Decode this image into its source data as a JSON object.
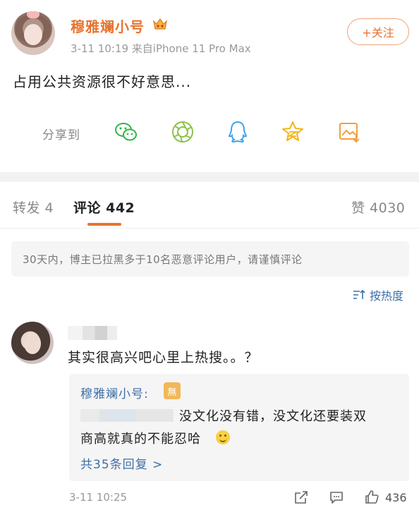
{
  "post": {
    "username": "穆雅斓小号",
    "meta": "3-11 10:19  来自iPhone 11 Pro Max",
    "follow_label": "+关注",
    "text": "占用公共资源很不好意思..."
  },
  "share": {
    "label": "分享到",
    "icons": [
      "wechat-icon",
      "moments-icon",
      "qq-icon",
      "qzone-icon",
      "save-image-icon"
    ]
  },
  "tabs": {
    "repost": "转发 4",
    "comment": "评论 442",
    "like": "赞 4030"
  },
  "notice": "30天内，博主已拉黑多于10名恶意评论用户，请谨慎评论",
  "sort_label": "按热度",
  "comment": {
    "text": "其实很高兴吧心里上热搜。。？",
    "reply": {
      "author": "穆雅斓小号:",
      "line1": "没文化没有错，没文化还要装双",
      "line2": "商高就真的不能忍哈",
      "more": "共35条回复 >"
    },
    "time": "3-11 10:25",
    "likes": "436"
  },
  "colors": {
    "accent": "#e8732f",
    "link": "#3d6fa8",
    "muted": "#999999"
  }
}
